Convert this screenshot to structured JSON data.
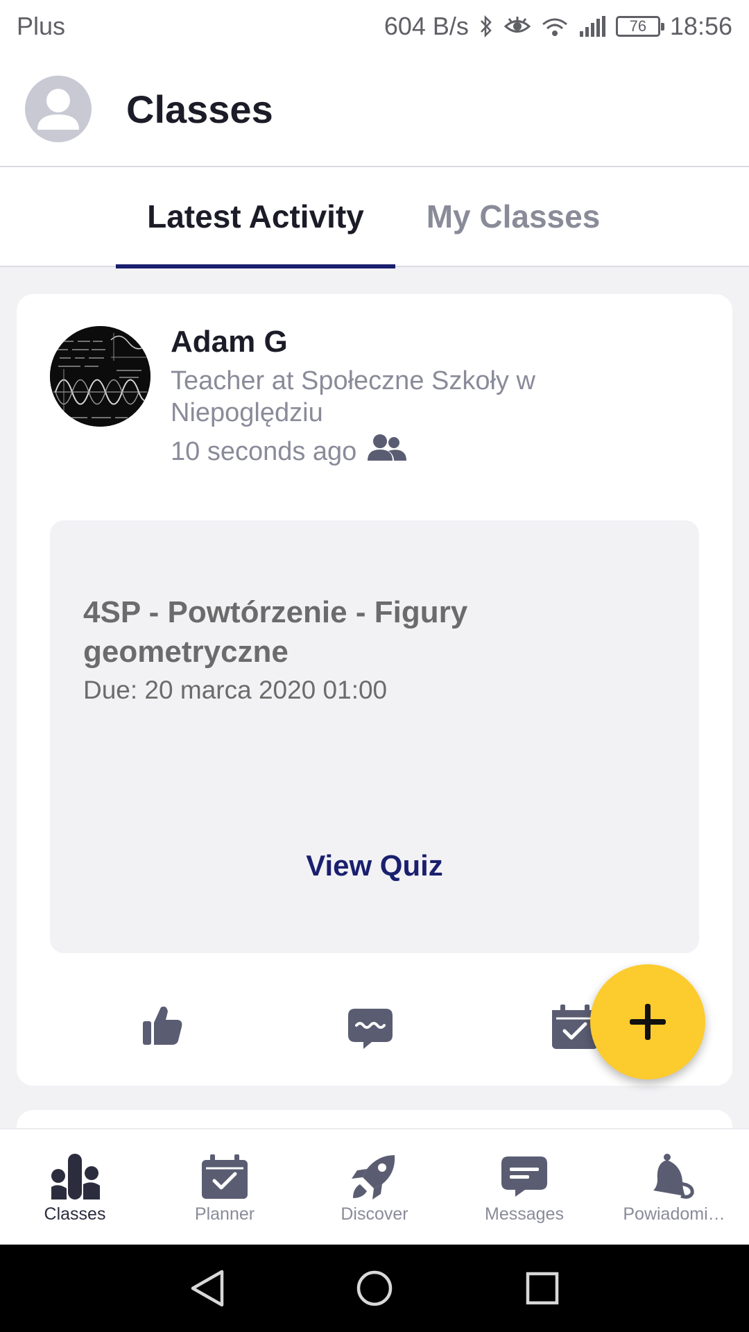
{
  "status_bar": {
    "carrier": "Plus",
    "net_speed": "604 B/s",
    "battery": "76",
    "time": "18:56"
  },
  "header": {
    "title": "Classes",
    "avatar_icon": "user-placeholder-icon"
  },
  "tabs": [
    {
      "label": "Latest Activity",
      "active": true
    },
    {
      "label": "My Classes",
      "active": false
    }
  ],
  "post": {
    "author_name": "Adam G",
    "author_role": "Teacher at Społeczne Szkoły w Niepoględziu",
    "time_ago": "10 seconds ago",
    "audience_icon": "group-icon",
    "quiz": {
      "title": "4SP - Powtórzenie - Figury geometryczne",
      "due": "Due: 20 marca 2020 01:00",
      "action_label": "View Quiz"
    },
    "actions": [
      "like-icon",
      "comment-icon",
      "assign-icon"
    ]
  },
  "fab": {
    "icon": "plus-icon"
  },
  "bottom_nav": [
    {
      "label": "Classes",
      "icon": "classes-icon",
      "active": true
    },
    {
      "label": "Planner",
      "icon": "planner-icon",
      "active": false
    },
    {
      "label": "Discover",
      "icon": "rocket-icon",
      "active": false
    },
    {
      "label": "Messages",
      "icon": "messages-icon",
      "active": false
    },
    {
      "label": "Powiadomi…",
      "icon": "bell-icon",
      "active": false
    }
  ],
  "colors": {
    "accent": "#1a1f6e",
    "fab": "#fccb2e",
    "icon_gray": "#5a5d72",
    "muted_text": "#8a8b99",
    "background": "#f2f2f5"
  }
}
